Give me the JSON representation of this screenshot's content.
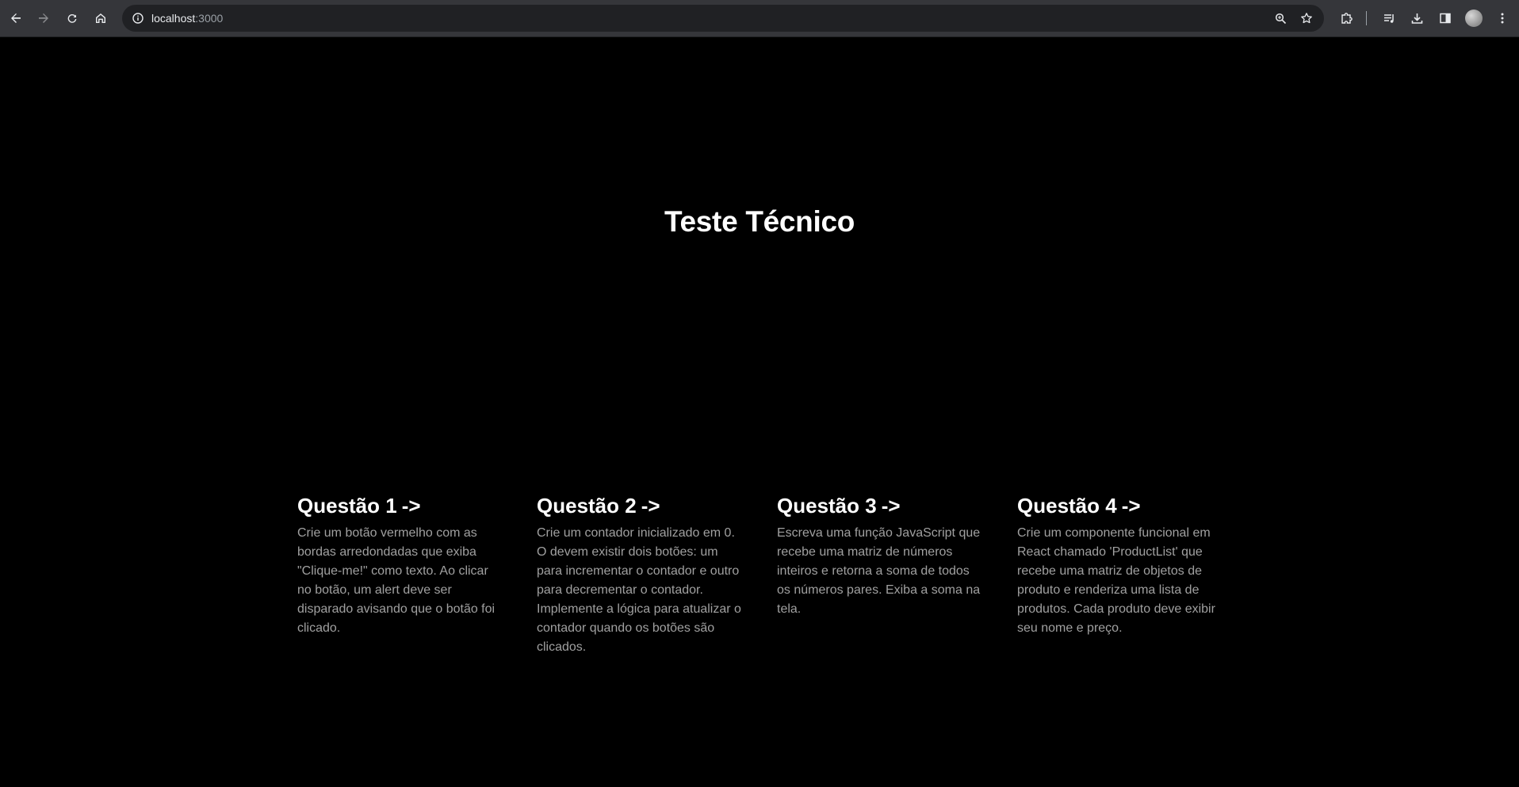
{
  "browser": {
    "url_host": "localhost",
    "url_port": ":3000"
  },
  "page": {
    "title": "Teste Técnico"
  },
  "cards": [
    {
      "title": "Questão 1",
      "arrow": "->",
      "description": "Crie um botão vermelho com as bordas arredondadas que exiba \"Clique-me!\" como texto. Ao clicar no botão, um alert deve ser disparado avisando que o botão foi clicado."
    },
    {
      "title": "Questão 2",
      "arrow": "->",
      "description": "Crie um contador inicializado em 0. O devem existir dois botões: um para incrementar o contador e outro para decrementar o contador. Implemente a lógica para atualizar o contador quando os botões são clicados."
    },
    {
      "title": "Questão 3",
      "arrow": "->",
      "description": "Escreva uma função JavaScript que recebe uma matriz de números inteiros e retorna a soma de todos os números pares. Exiba a soma na tela."
    },
    {
      "title": "Questão 4",
      "arrow": "->",
      "description": "Crie um componente funcional em React chamado 'ProductList' que recebe uma matriz de objetos de produto e renderiza uma lista de produtos. Cada produto deve exibir seu nome e preço."
    }
  ]
}
